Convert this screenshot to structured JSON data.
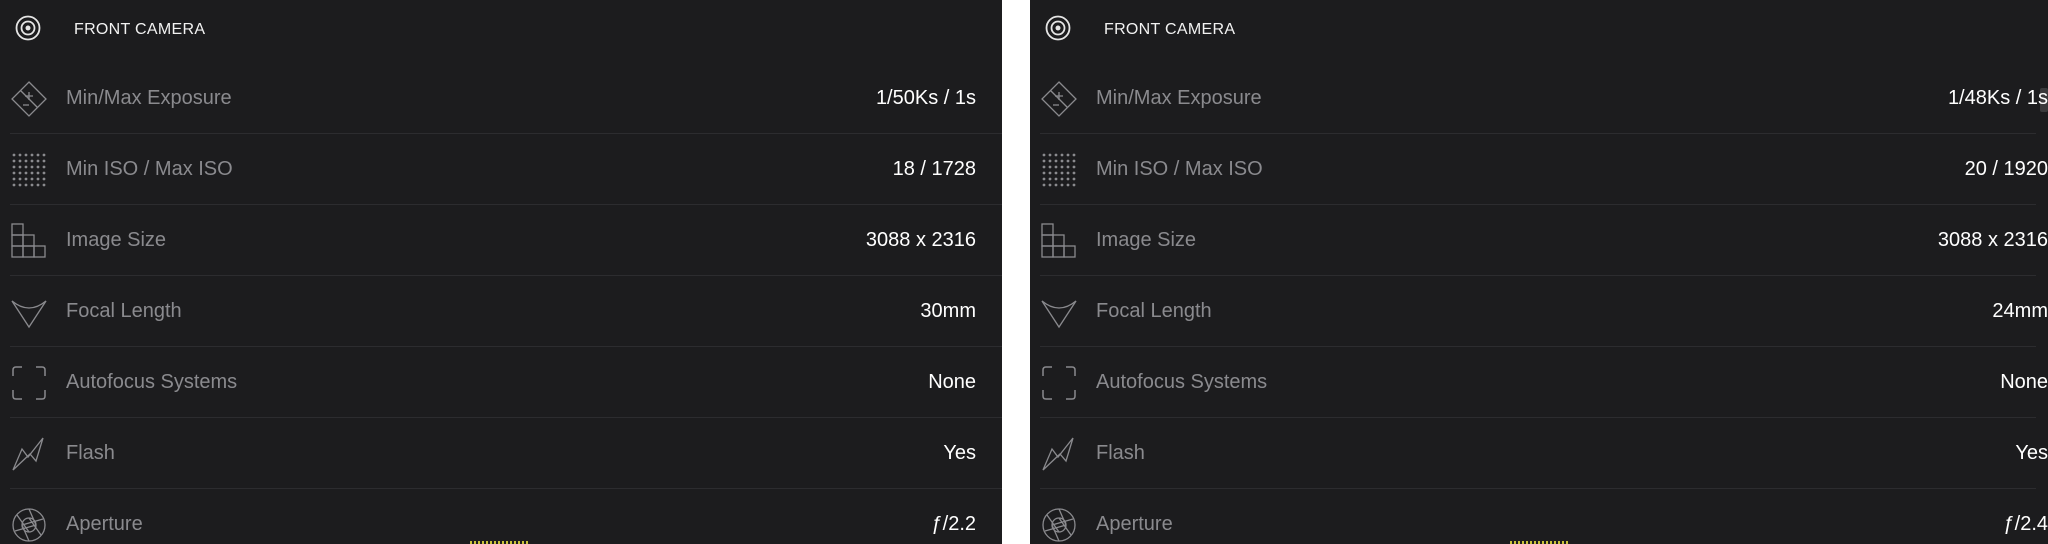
{
  "panels": [
    {
      "header": {
        "title": "FRONT CAMERA",
        "icon": "camera-lens-icon"
      },
      "rows": [
        {
          "label": "Min/Max Exposure",
          "value": "1/50Ks / 1s",
          "icon": "exposure-icon"
        },
        {
          "label": "Min ISO / Max ISO",
          "value": "18 / 1728",
          "icon": "iso-grid-icon"
        },
        {
          "label": "Image Size",
          "value": "3088 x 2316",
          "icon": "image-size-icon"
        },
        {
          "label": "Focal Length",
          "value": "30mm",
          "icon": "focal-length-icon"
        },
        {
          "label": "Autofocus Systems",
          "value": "None",
          "icon": "autofocus-icon"
        },
        {
          "label": "Flash",
          "value": "Yes",
          "icon": "flash-icon"
        },
        {
          "label": "Aperture",
          "value": "ƒ/2.2",
          "icon": "aperture-icon"
        }
      ]
    },
    {
      "header": {
        "title": "FRONT CAMERA",
        "icon": "camera-lens-icon"
      },
      "rows": [
        {
          "label": "Min/Max Exposure",
          "value": "1/48Ks / 1s",
          "icon": "exposure-icon"
        },
        {
          "label": "Min ISO / Max ISO",
          "value": "20 / 1920",
          "icon": "iso-grid-icon"
        },
        {
          "label": "Image Size",
          "value": "3088 x 2316",
          "icon": "image-size-icon"
        },
        {
          "label": "Focal Length",
          "value": "24mm",
          "icon": "focal-length-icon"
        },
        {
          "label": "Autofocus Systems",
          "value": "None",
          "icon": "autofocus-icon"
        },
        {
          "label": "Flash",
          "value": "Yes",
          "icon": "flash-icon"
        },
        {
          "label": "Aperture",
          "value": "ƒ/2.4",
          "icon": "aperture-icon"
        }
      ]
    }
  ],
  "colors": {
    "background": "#1c1c1e",
    "label": "#8a8a8e",
    "value": "#ffffff",
    "separator": "#2c2c2f"
  }
}
